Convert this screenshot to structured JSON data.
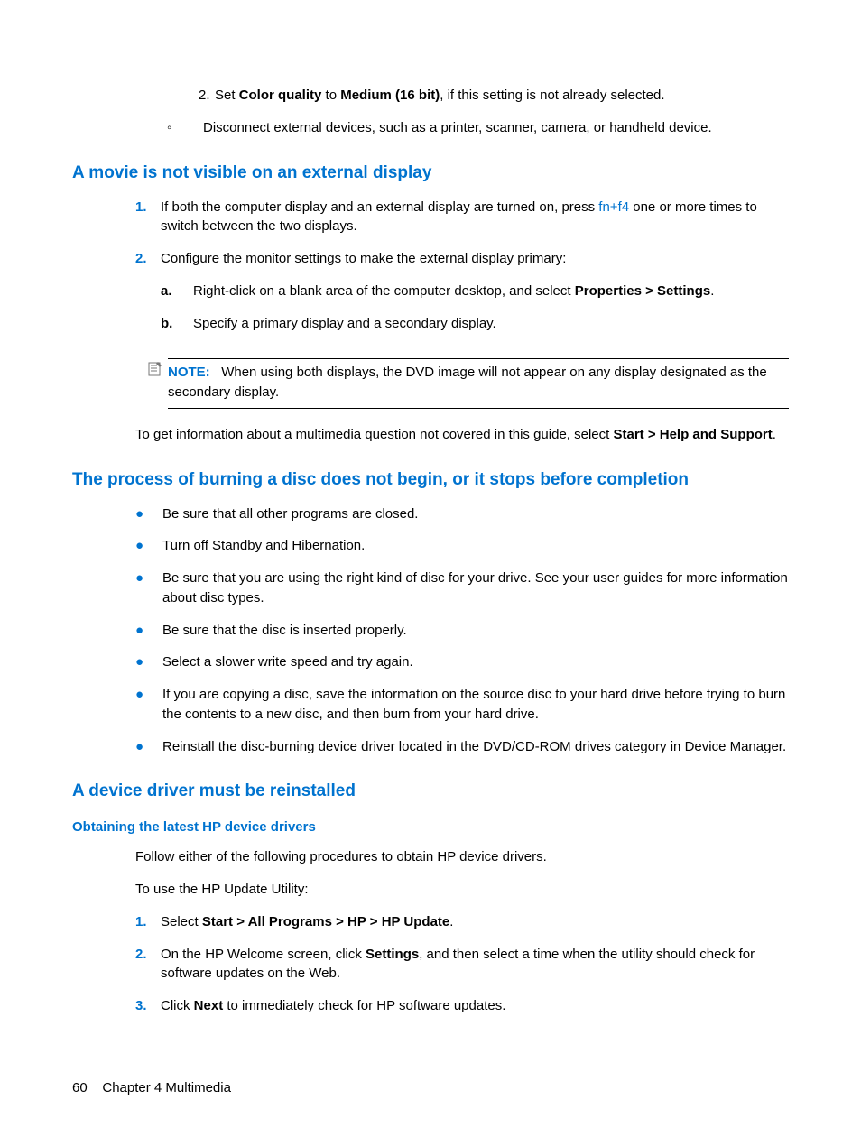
{
  "steps_top": [
    {
      "n": "2.",
      "pre": "Set ",
      "b1": "Color quality",
      "mid": " to ",
      "b2": "Medium (16 bit)",
      "post": ", if this setting is not already selected."
    }
  ],
  "circ": [
    "Disconnect external devices, such as a printer, scanner, camera, or handheld device."
  ],
  "h_movie": "A movie is not visible on an external display",
  "movie_steps": [
    {
      "n": "1.",
      "pre": "If both the computer display and an external display are turned on, press ",
      "link": "fn+f4",
      "post": " one or more times to switch between the two displays."
    },
    {
      "n": "2.",
      "txt": "Configure the monitor settings to make the external display primary:"
    }
  ],
  "movie_sub": [
    {
      "a": "a.",
      "pre": "Right-click on a blank area of the computer desktop, and select ",
      "b": "Properties > Settings",
      "post": "."
    },
    {
      "a": "b.",
      "txt": "Specify a primary display and a secondary display."
    }
  ],
  "note_label": "NOTE:",
  "note_body": "When using both displays, the DVD image will not appear on any display designated as the secondary display.",
  "info_para_pre": "To get information about a multimedia question not covered in this guide, select ",
  "info_para_b": "Start > Help and Support",
  "info_para_post": ".",
  "h_burn": "The process of burning a disc does not begin, or it stops before completion",
  "burn_bullets": [
    "Be sure that all other programs are closed.",
    "Turn off Standby and Hibernation.",
    "Be sure that you are using the right kind of disc for your drive. See your user guides for more information about disc types.",
    "Be sure that the disc is inserted properly.",
    "Select a slower write speed and try again.",
    "If you are copying a disc, save the information on the source disc to your hard drive before trying to burn the contents to a new disc, and then burn from your hard drive.",
    "Reinstall the disc-burning device driver located in the DVD/CD-ROM drives category in Device Manager."
  ],
  "h_driver": "A device driver must be reinstalled",
  "h_obtain": "Obtaining the latest HP device drivers",
  "obtain_p1": "Follow either of the following procedures to obtain HP device drivers.",
  "obtain_p2": "To use the HP Update Utility:",
  "obtain_steps": [
    {
      "n": "1.",
      "pre": "Select ",
      "b": "Start > All Programs > HP > HP Update",
      "post": "."
    },
    {
      "n": "2.",
      "pre": "On the HP Welcome screen, click ",
      "b": "Settings",
      "post": ", and then select a time when the utility should check for software updates on the Web."
    },
    {
      "n": "3.",
      "pre": "Click ",
      "b": "Next",
      "post": " to immediately check for HP software updates."
    }
  ],
  "footer_page": "60",
  "footer_chap": "Chapter 4   Multimedia"
}
